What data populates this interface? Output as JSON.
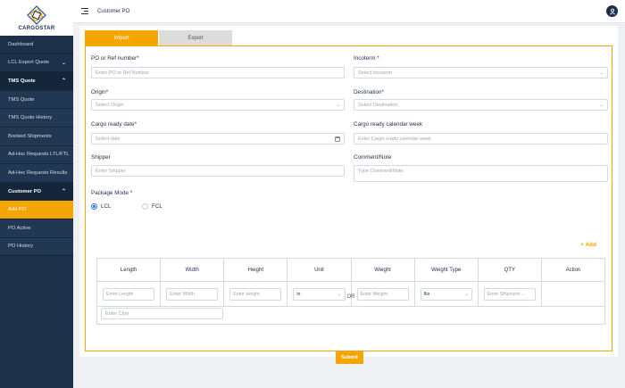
{
  "app": {
    "brand": "CARGOSTAR"
  },
  "sidebar": {
    "items": [
      {
        "label": "Dashboard"
      },
      {
        "label": "LCL Export Quote"
      },
      {
        "label": "TMS Quote"
      },
      {
        "label": "TMS Quote"
      },
      {
        "label": "TMS Quote History"
      },
      {
        "label": "Booked Shipments"
      },
      {
        "label": "Ad-Hoc Requests LTL/FTL"
      },
      {
        "label": "Ad-Hoc Requests Results"
      },
      {
        "label": "Customer PO"
      },
      {
        "label": "Add PO"
      },
      {
        "label": "PO Active"
      },
      {
        "label": "PO History"
      }
    ]
  },
  "header": {
    "title": "Customer PO"
  },
  "tabs": {
    "import": "Import",
    "export": "Export"
  },
  "form": {
    "po": {
      "label": "PO or Ref number*",
      "placeholder": "Enter PO or Ref Number"
    },
    "incoterm": {
      "label": "Incoterm *",
      "placeholder": "Select Incoterm"
    },
    "origin": {
      "label": "Origin*",
      "placeholder": "Select Origin"
    },
    "destination": {
      "label": "Destination*",
      "placeholder": "Select Destination"
    },
    "ready_date": {
      "label": "Cargo ready date*",
      "placeholder": "Select date"
    },
    "ready_week": {
      "label": "Cargo ready calendar week",
      "placeholder": "Enter Cargo ready calendar week"
    },
    "shipper": {
      "label": "Shipper",
      "placeholder": "Enter Shipper"
    },
    "comment": {
      "label": "Comment/Note",
      "placeholder": "Type Comment/Note"
    },
    "package_mode": {
      "label": "Package Mode *",
      "options": [
        "LCL",
        "FCL"
      ],
      "selected": "LCL"
    },
    "add_label": "+ Add",
    "table": {
      "headers": [
        "Length",
        "Width",
        "Height",
        "Unit",
        "Weight",
        "Weight Type",
        "QTY",
        "Action"
      ],
      "row": {
        "length": "Enter Length",
        "width": "Enter Width",
        "height": "Enter Height",
        "unit": "in",
        "weight": "Enter Weight",
        "weight_type": "lbs",
        "qty": "Enter Shipment ..."
      }
    },
    "or": "OR",
    "cbm": {
      "placeholder": "Enter Cbm"
    },
    "submit": "Submit"
  },
  "colors": {
    "accent": "#f5a500",
    "sidebar": "#1c3049",
    "radio": "#2c7be5"
  }
}
